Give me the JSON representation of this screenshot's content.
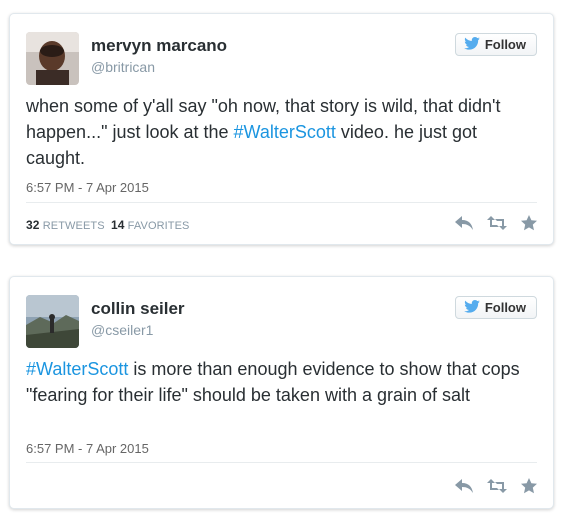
{
  "tweets": [
    {
      "name": "mervyn marcano",
      "handle": "@britrican",
      "follow_label": "Follow",
      "text_before": "when some of y'all say \"oh now, that story is wild, that didn't happen...\" just look at the ",
      "hashtag": "#WalterScott",
      "text_after": " video. he just got caught.",
      "timestamp": "6:57 PM - 7 Apr 2015",
      "retweets_count": "32",
      "retweets_label": "RETWEETS",
      "favorites_count": "14",
      "favorites_label": "FAVORITES"
    },
    {
      "name": "collin seiler",
      "handle": "@cseiler1",
      "follow_label": "Follow",
      "text_before": "",
      "hashtag": "#WalterScott",
      "text_after": " is more than enough evidence to show that cops \"fearing for their life\" should be taken with a grain of salt",
      "timestamp": "6:57 PM - 7 Apr 2015"
    }
  ],
  "colors": {
    "link": "#1b95e0",
    "twitter_blue": "#55acee",
    "icon_gray": "#8899a6"
  },
  "icons": [
    "reply-icon",
    "retweet-icon",
    "favorite-icon",
    "twitter-bird-icon"
  ]
}
